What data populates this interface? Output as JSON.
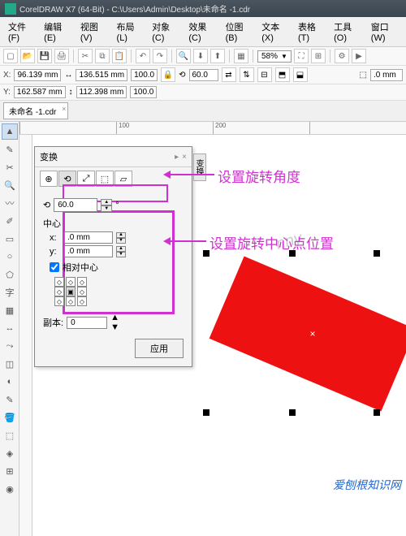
{
  "title": "CorelDRAW X7 (64-Bit) - C:\\Users\\Admin\\Desktop\\未命名 -1.cdr",
  "menu": {
    "file": "文件(F)",
    "edit": "编辑(E)",
    "view": "视图(V)",
    "layout": "布局(L)",
    "object": "对象(C)",
    "effect": "效果(C)",
    "bitmap": "位图(B)",
    "text": "文本(X)",
    "table": "表格(T)",
    "tools": "工具(O)",
    "window": "窗口(W)"
  },
  "toolbar": {
    "zoom": "58%"
  },
  "propbar": {
    "x_label": "X:",
    "y_label": "Y:",
    "x_pos": "96.139 mm",
    "y_pos": "162.587 mm",
    "width": "136.515 mm",
    "height": "112.398 mm",
    "scale_x": "100.0",
    "scale_y": "100.0",
    "rotation": "60.0",
    "stroke_width": ".0 mm"
  },
  "tab": {
    "name": "未命名 -1.cdr"
  },
  "ruler": {
    "t0": "",
    "t1": "100",
    "t2": "200"
  },
  "docker": {
    "title": "变换",
    "side_tab": "变换",
    "angle_icon": "⟲",
    "angle_value": "60.0",
    "angle_unit": "°",
    "center_label": "中心",
    "x_label": "x:",
    "y_label": "y:",
    "x_value": ".0 mm",
    "y_value": ".0 mm",
    "relative_label": "相对中心",
    "copies_label": "副本:",
    "copies_value": "0",
    "apply_label": "应用"
  },
  "annotations": {
    "angle": "设置旋转角度",
    "center": "设置旋转中心点位置"
  },
  "watermark": "爱刨根知识网",
  "canvas_wm": "nny"
}
